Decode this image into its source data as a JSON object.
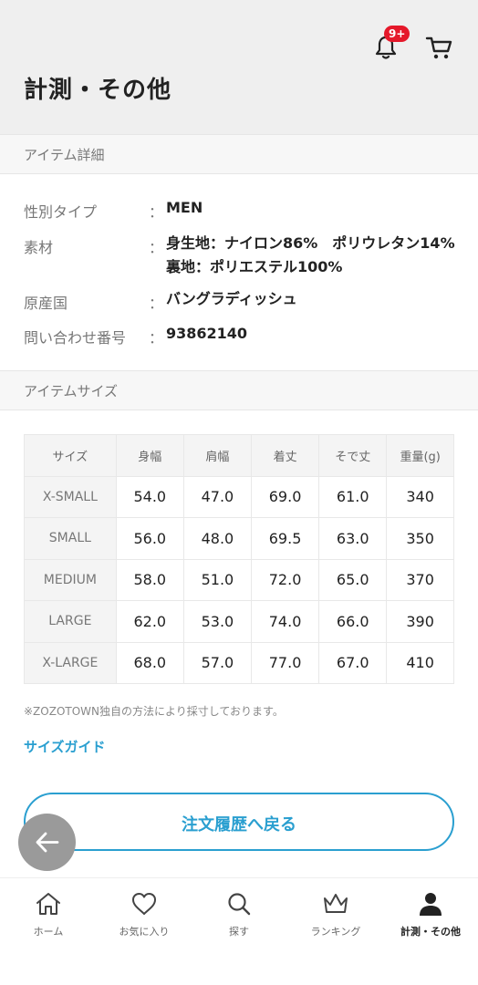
{
  "header": {
    "title": "計測・その他",
    "notification_badge": "9+",
    "icons": [
      "bell-icon",
      "cart-icon"
    ]
  },
  "item_details": {
    "section_title": "アイテム詳細",
    "rows": [
      {
        "label": "性別タイプ",
        "colon": "：",
        "value": "MEN"
      },
      {
        "label": "素材",
        "colon": "：",
        "value": "身生地：ナイロン86%　ポリウレタン14%　裏地：ポリエステル100%"
      },
      {
        "label": "原産国",
        "colon": "：",
        "value": "バングラディッシュ"
      },
      {
        "label": "問い合わせ番号",
        "colon": "：",
        "value": "93862140"
      }
    ]
  },
  "item_size": {
    "section_title": "アイテムサイズ",
    "headers": [
      "サイズ",
      "身幅",
      "肩幅",
      "着丈",
      "そで丈",
      "重量(g)"
    ],
    "rows": [
      [
        "X-SMALL",
        "54.0",
        "47.0",
        "69.0",
        "61.0",
        "340"
      ],
      [
        "SMALL",
        "56.0",
        "48.0",
        "69.5",
        "63.0",
        "350"
      ],
      [
        "MEDIUM",
        "58.0",
        "51.0",
        "72.0",
        "65.0",
        "370"
      ],
      [
        "LARGE",
        "62.0",
        "53.0",
        "74.0",
        "66.0",
        "390"
      ],
      [
        "X-LARGE",
        "68.0",
        "57.0",
        "77.0",
        "67.0",
        "410"
      ]
    ],
    "note": "※ZOZOTOWN独自の方法により採寸しております。",
    "guide_link": "サイズガイド"
  },
  "order_button": "注文履歴へ戻る",
  "tabbar": [
    {
      "label": "ホーム",
      "icon": "home-icon"
    },
    {
      "label": "お気に入り",
      "icon": "heart-icon"
    },
    {
      "label": "探す",
      "icon": "search-icon"
    },
    {
      "label": "ランキング",
      "icon": "crown-icon"
    },
    {
      "label": "計測・その他",
      "icon": "person-icon",
      "active": true
    }
  ],
  "colors": {
    "accent": "#2a9fd0",
    "badge": "#e5182a",
    "header_bg": "#efefef"
  }
}
